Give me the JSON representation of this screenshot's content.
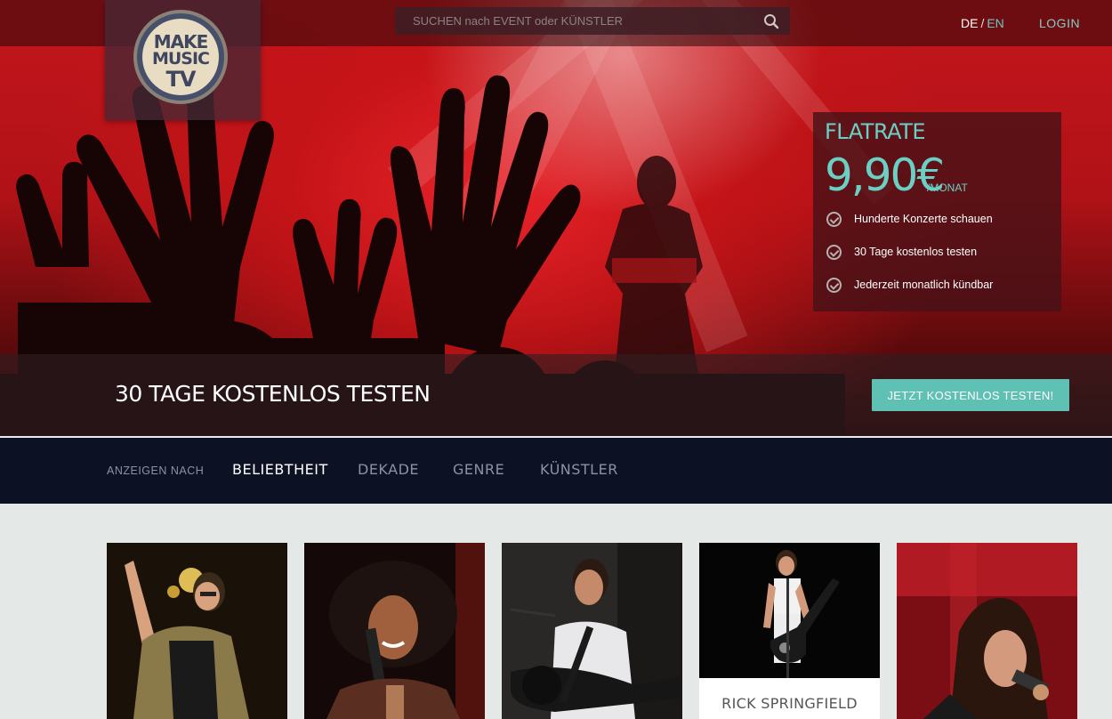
{
  "header": {
    "logo": {
      "line1": "MAKE",
      "line2": "MUSIC",
      "line3": "TV"
    },
    "search": {
      "placeholder": "SUCHEN nach EVENT oder KÜNSTLER",
      "value": ""
    },
    "lang": {
      "de": "DE",
      "sep": "/",
      "en": "EN"
    },
    "login": "LOGIN"
  },
  "offer": {
    "label": "FLATRATE",
    "price": "9,90€",
    "per": "/MONAT",
    "features": [
      "Hunderte Konzerte schauen",
      "30 Tage kostenlos testen",
      "Jederzeit monatlich kündbar"
    ]
  },
  "banner": {
    "text": "30 TAGE KOSTENLOS TESTEN",
    "cta": "JETZT KOSTENLOS TESTEN!"
  },
  "filter": {
    "label": "ANZEIGEN NACH",
    "options": [
      "BELIEBTHEIT",
      "DEKADE",
      "GENRE",
      "KÜNSTLER"
    ],
    "active": "BELIEBTHEIT"
  },
  "cards": [
    {
      "caption": ""
    },
    {
      "caption": ""
    },
    {
      "caption": ""
    },
    {
      "caption": "RICK SPRINGFIELD"
    },
    {
      "caption": ""
    }
  ],
  "colors": {
    "accent": "#5fc1b4",
    "hero_red": "#c4161c",
    "nav_bg": "#0c1123",
    "page_bg": "#e4e8e7"
  },
  "icons": {
    "search": "search-icon",
    "check": "check-circle-icon"
  }
}
